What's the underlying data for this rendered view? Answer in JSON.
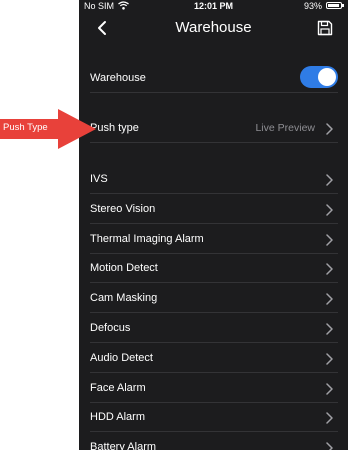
{
  "status_bar": {
    "carrier": "No SIM",
    "time": "12:01 PM",
    "battery_pct": "93%",
    "battery_level": 0.93
  },
  "header": {
    "title": "Warehouse"
  },
  "toggle_row": {
    "label": "Warehouse",
    "enabled": true
  },
  "push_row": {
    "label": "Push type",
    "value": "Live Preview"
  },
  "alarms": [
    "IVS",
    "Stereo Vision",
    "Thermal Imaging Alarm",
    "Motion Detect",
    "Cam Masking",
    "Defocus",
    "Audio Detect",
    "Face Alarm",
    "HDD Alarm",
    "Battery Alarm"
  ],
  "callout": {
    "text": "Push Type"
  },
  "colors": {
    "background": "#1c1c1e",
    "accent": "#2f7ce6",
    "callout": "#e8413a"
  }
}
